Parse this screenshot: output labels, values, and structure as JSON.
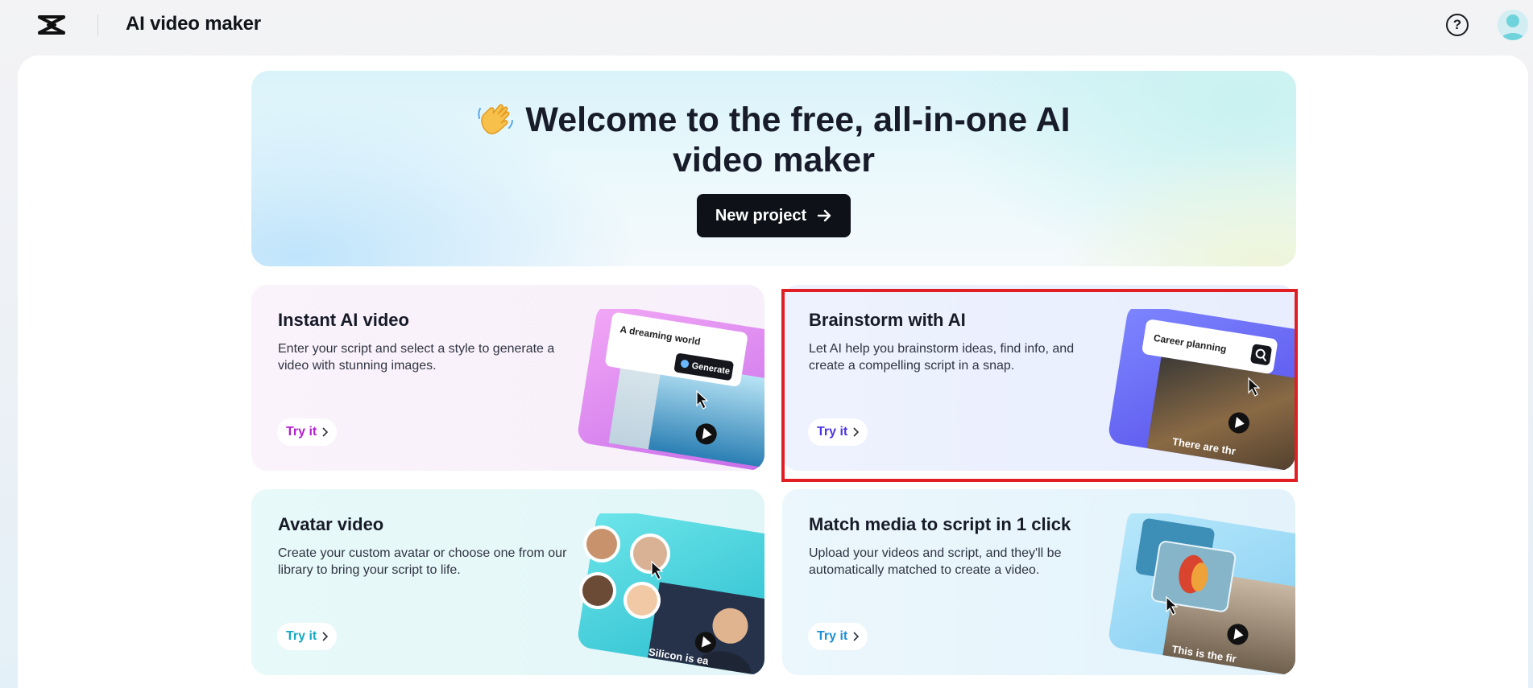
{
  "header": {
    "app_title": "AI video maker",
    "logo_icon": "capcut-logo-icon",
    "help_icon": "help-icon",
    "avatar_icon": "user-avatar"
  },
  "hero": {
    "emoji": "👋",
    "title_line1": "Welcome to the free, all-in-one AI",
    "title_line2": "video maker",
    "new_project_label": "New project"
  },
  "cards": [
    {
      "title": "Instant AI video",
      "description": "Enter your script and select a style to generate a video with stunning images.",
      "try_label": "Try it",
      "illus_input": "A dreaming world",
      "illus_button": "Generate",
      "accent": "#b41fd1"
    },
    {
      "title": "Brainstorm with AI",
      "description": "Let AI help you brainstorm ideas, find info, and create a compelling script in a snap.",
      "try_label": "Try it",
      "illus_input": "Career planning",
      "illus_caption": "There are thr",
      "accent": "#4c36e4"
    },
    {
      "title": "Avatar video",
      "description": "Create your custom avatar or choose one from our library to bring your script to life.",
      "try_label": "Try it",
      "illus_caption": "Silicon is ea",
      "accent": "#15a9c4"
    },
    {
      "title": "Match media to script in 1 click",
      "description": "Upload your videos and script, and they'll be automatically matched to create a video.",
      "try_label": "Try it",
      "illus_caption": "This is the fir",
      "accent": "#1f8fd6"
    }
  ],
  "colors": {
    "highlight_border": "#e01e23",
    "new_project_bg": "#0e1117"
  }
}
